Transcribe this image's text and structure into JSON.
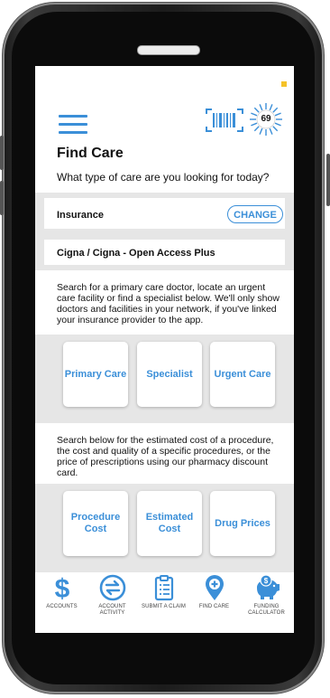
{
  "colors": {
    "accent": "#3b8fd8",
    "band": "#e6e6e6",
    "status": "#f5c229"
  },
  "header": {
    "score": "69",
    "title": "Find Care",
    "subtitle": "What type of care are you looking for today?"
  },
  "insurance": {
    "label": "Insurance",
    "change_label": "CHANGE",
    "plan": "Cigna / Cigna - Open Access Plus"
  },
  "care_section": {
    "description": "Search for a primary care doctor, locate an urgent care facility or find a specialist below. We'll only show doctors and facilities in your network, if you've linked your insurance provider to the app.",
    "cards": [
      {
        "label": "Primary Care"
      },
      {
        "label": "Specialist"
      },
      {
        "label": "Urgent Care"
      }
    ]
  },
  "cost_section": {
    "description": "Search below for the estimated cost of a procedure, the cost and quality of a specific procedures, or the price of prescriptions using our pharmacy discount card.",
    "cards": [
      {
        "label": "Procedure Cost"
      },
      {
        "label": "Estimated Cost"
      },
      {
        "label": "Drug Prices"
      }
    ]
  },
  "bottom_nav": {
    "items": [
      {
        "label": "ACCOUNTS",
        "icon": "dollar-icon"
      },
      {
        "label": "ACCOUNT ACTIVITY",
        "icon": "transfer-icon"
      },
      {
        "label": "SUBMIT A CLAIM",
        "icon": "clipboard-icon"
      },
      {
        "label": "FIND CARE",
        "icon": "location-plus-icon"
      },
      {
        "label": "FUNDING CALCULATOR",
        "icon": "piggy-bank-icon"
      }
    ]
  }
}
